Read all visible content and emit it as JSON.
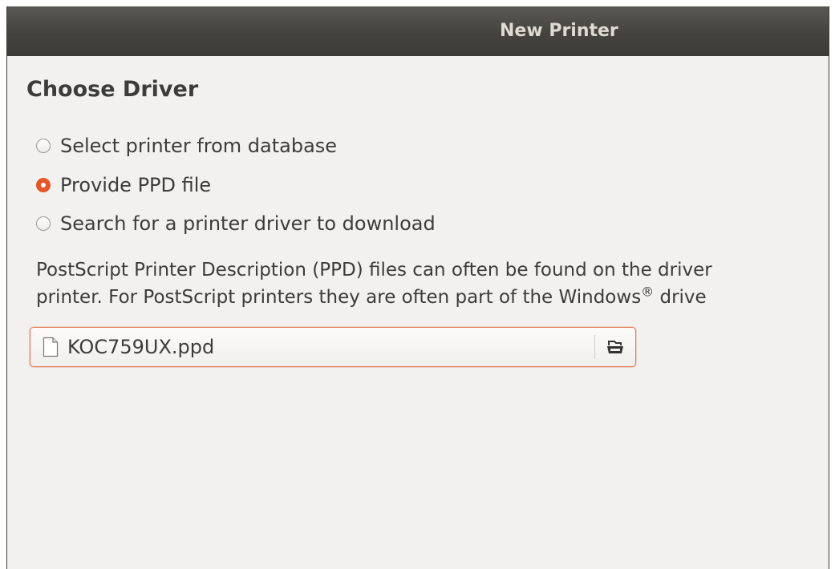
{
  "window": {
    "title": "New Printer"
  },
  "page": {
    "heading": "Choose Driver"
  },
  "options": [
    {
      "label": "Select printer from database",
      "checked": false
    },
    {
      "label": "Provide PPD file",
      "checked": true
    },
    {
      "label": "Search for a printer driver to download",
      "checked": false
    }
  ],
  "description": {
    "line1": "PostScript Printer Description (PPD) files can often be found on the driver",
    "line2_prefix": "printer. For PostScript printers they are often part of the Windows",
    "line2_sup": "®",
    "line2_suffix": " drive"
  },
  "file_chooser": {
    "value": "KOC759UX.ppd",
    "file_icon": "document-icon",
    "button_icon": "folder-open-icon"
  },
  "colors": {
    "accent": "#e4562a",
    "titlebar": "#3c3b37",
    "background": "#f2f1f0"
  }
}
